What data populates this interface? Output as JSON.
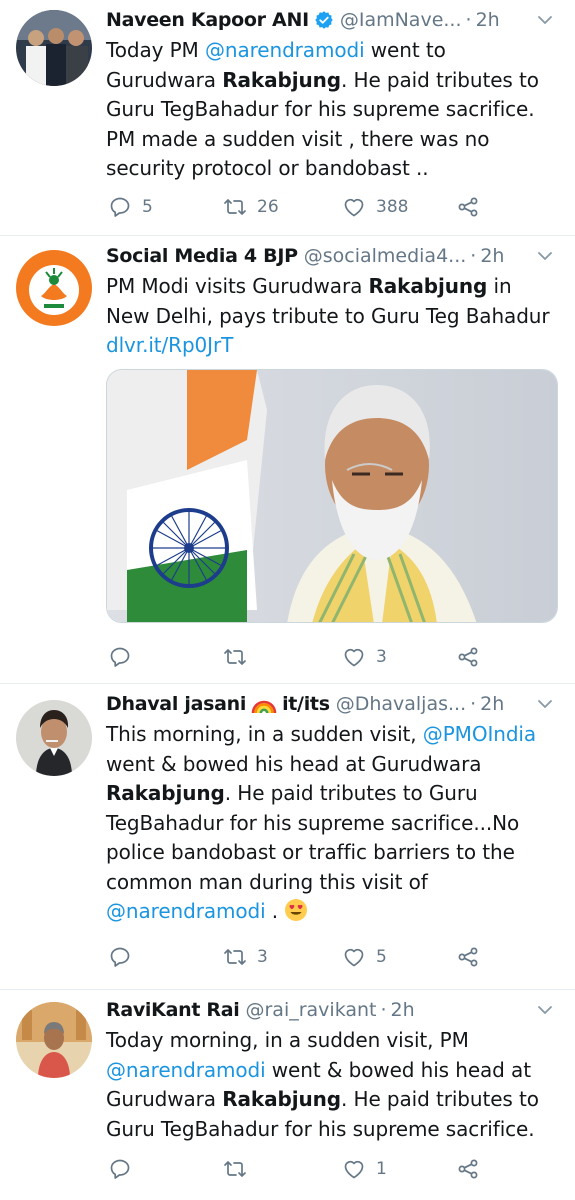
{
  "tweets": [
    {
      "name": "Naveen Kapoor ANI",
      "handle": "@IamNave...",
      "time": "2h",
      "text_parts": [
        {
          "t": "Today PM ",
          "s": "plain"
        },
        {
          "t": "@narendramodi",
          "s": "link"
        },
        {
          "t": "  went to Gurudwara ",
          "s": "plain"
        },
        {
          "t": "Rakabjung",
          "s": "bold"
        },
        {
          "t": ". He paid tributes to Guru TegBahadur for his supreme sacrifice. PM made a sudden visit , there was no security protocol or bandobast ..",
          "s": "plain"
        }
      ],
      "replies": "5",
      "retweets": "26",
      "likes": "388"
    },
    {
      "name": "Social Media 4 BJP",
      "handle": "@socialmedia4...",
      "time": "2h",
      "text_parts": [
        {
          "t": "PM Modi visits Gurudwara ",
          "s": "plain"
        },
        {
          "t": "Rakabjung",
          "s": "bold"
        },
        {
          "t": " in New Delhi, pays tribute to Guru Teg Bahadur ",
          "s": "plain"
        },
        {
          "t": "dlvr.it/Rp0JrT",
          "s": "link"
        }
      ],
      "replies": "",
      "retweets": "",
      "likes": "3"
    },
    {
      "name": "Dhaval jasani",
      "name_suffix": "it/its",
      "handle": "@Dhavaljas...",
      "time": "2h",
      "text_parts": [
        {
          "t": "This morning, in a sudden visit, ",
          "s": "plain"
        },
        {
          "t": "@PMOIndia",
          "s": "link"
        },
        {
          "t": " went & bowed his head at Gurudwara ",
          "s": "plain"
        },
        {
          "t": "Rakabjung",
          "s": "bold"
        },
        {
          "t": ". He paid tributes to Guru TegBahadur for his supreme sacrifice...No police bandobast or traffic barriers to the common man during this visit of ",
          "s": "plain"
        },
        {
          "t": "@narendramodi",
          "s": "link"
        },
        {
          "t": " . ",
          "s": "plain"
        }
      ],
      "replies": "",
      "retweets": "3",
      "likes": "5"
    },
    {
      "name": "RaviKant Rai",
      "handle": "@rai_ravikant",
      "time": "2h",
      "text_parts": [
        {
          "t": "Today morning, in a sudden visit, PM ",
          "s": "plain"
        },
        {
          "t": "@narendramodi",
          "s": "link"
        },
        {
          "t": " went & bowed his head at Gurudwara ",
          "s": "plain"
        },
        {
          "t": "Rakabjung",
          "s": "bold"
        },
        {
          "t": ". He paid tributes to Guru TegBahadur for his supreme sacrifice.",
          "s": "plain"
        }
      ],
      "replies": "",
      "retweets": "",
      "likes": "1"
    }
  ],
  "icons": {
    "verified": "verified-badge-icon",
    "reply": "reply-icon",
    "retweet": "retweet-icon",
    "like": "heart-icon",
    "share": "share-icon",
    "caret": "chevron-down-icon"
  },
  "colors": {
    "link": "#1b95e0",
    "muted": "#657786",
    "text": "#14171a"
  }
}
